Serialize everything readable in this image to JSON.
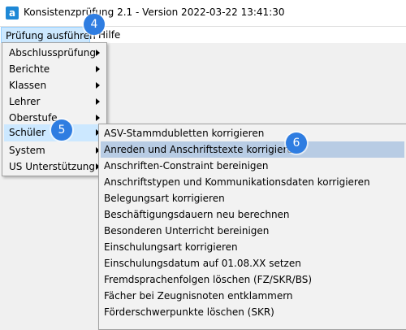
{
  "window": {
    "title": "Konsistenzprüfung 2.1 - Version 2022-03-22 13:41:30",
    "icon": "app-logo-icon",
    "icon_letter": "a"
  },
  "menubar": {
    "items": [
      {
        "label": "Prüfung ausführen"
      },
      {
        "label": "Hilfe"
      }
    ]
  },
  "main_menu": {
    "items": [
      {
        "label": "Abschlussprüfung",
        "has_submenu": true
      },
      {
        "label": "Berichte",
        "has_submenu": true
      },
      {
        "label": "Klassen",
        "has_submenu": true
      },
      {
        "label": "Lehrer",
        "has_submenu": true
      },
      {
        "label": "Oberstufe",
        "has_submenu": true
      },
      {
        "label": "Schüler",
        "has_submenu": true,
        "highlighted": true
      },
      {
        "label": "System",
        "has_submenu": true
      },
      {
        "label": "US Unterstützung",
        "has_submenu": true
      }
    ]
  },
  "submenu": {
    "items": [
      {
        "label": "ASV-Stammdubletten korrigieren"
      },
      {
        "label": "Anreden und Anschriftstexte korrigieren",
        "highlighted": true
      },
      {
        "label": "Anschriften-Constraint bereinigen"
      },
      {
        "label": "Anschriftstypen und Kommunikationsdaten korrigieren"
      },
      {
        "label": "Belegungsart korrigieren"
      },
      {
        "label": "Beschäftigungsdauern neu berechnen"
      },
      {
        "label": "Besonderen Unterricht bereinigen"
      },
      {
        "label": "Einschulungsart korrigieren"
      },
      {
        "label": "Einschulungsdatum auf 01.08.XX setzen"
      },
      {
        "label": "Fremdsprachenfolgen löschen (FZ/SKR/BS)"
      },
      {
        "label": "Fächer bei Zeugnisnoten entklammern"
      },
      {
        "label": "Förderschwerpunkte löschen (SKR)"
      }
    ]
  },
  "step_badges": [
    {
      "number": "4"
    },
    {
      "number": "5"
    },
    {
      "number": "6"
    }
  ],
  "colors": {
    "highlight": "#cce8ff",
    "submenu_highlight": "#b8cce4",
    "badge": "#2f7de1"
  }
}
